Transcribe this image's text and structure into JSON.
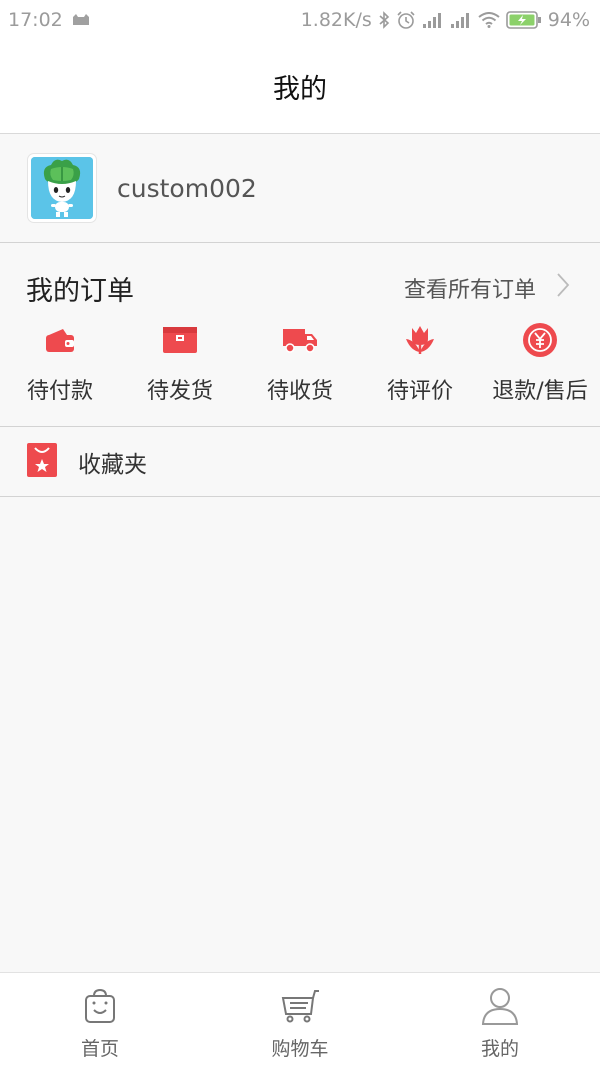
{
  "status_bar": {
    "time": "17:02",
    "network_speed": "1.82K/s",
    "battery": "94%",
    "icons": [
      "cat-icon",
      "bluetooth-icon",
      "alarm-icon",
      "signal-icon",
      "signal-icon",
      "wifi-icon",
      "battery-icon"
    ]
  },
  "nav": {
    "title": "我的"
  },
  "profile": {
    "username": "custom002"
  },
  "orders": {
    "title": "我的订单",
    "view_all": "查看所有订单",
    "items": [
      {
        "label": "待付款",
        "icon": "wallet-icon"
      },
      {
        "label": "待发货",
        "icon": "box-icon"
      },
      {
        "label": "待收货",
        "icon": "truck-icon"
      },
      {
        "label": "待评价",
        "icon": "tulip-icon"
      },
      {
        "label": "退款/售后",
        "icon": "yen-coin-icon"
      }
    ]
  },
  "favorites": {
    "label": "收藏夹",
    "icon": "bag-star-icon"
  },
  "tab_bar": {
    "tabs": [
      {
        "label": "首页",
        "icon": "shopping-bag-icon",
        "active": false
      },
      {
        "label": "购物车",
        "icon": "cart-icon",
        "active": false
      },
      {
        "label": "我的",
        "icon": "user-icon",
        "active": true
      }
    ]
  },
  "colors": {
    "accent": "#ee4a4e",
    "background": "#f8f8f8",
    "divider": "#d3d3d3",
    "status_text": "#9b9b9b"
  }
}
